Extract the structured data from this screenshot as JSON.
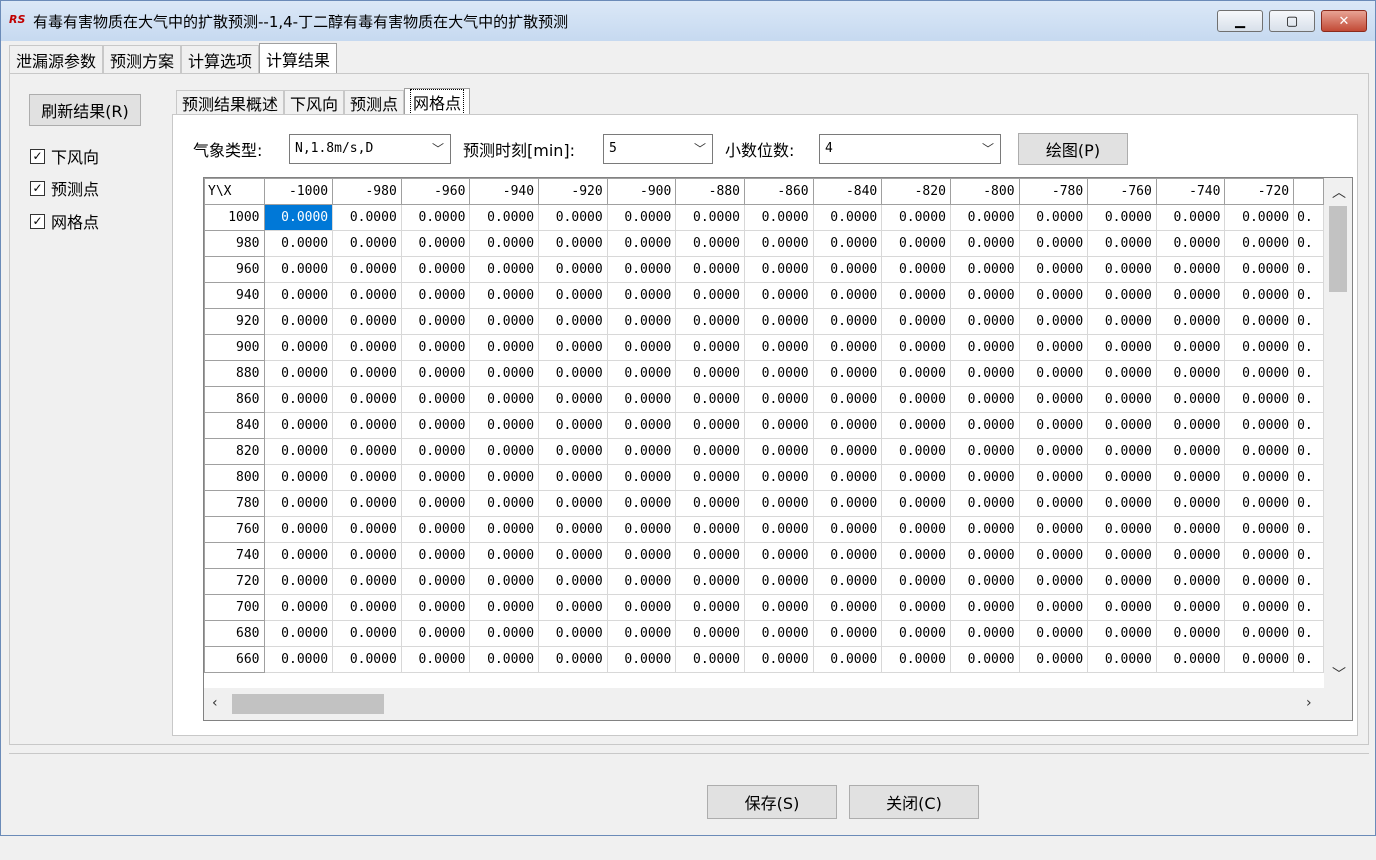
{
  "window": {
    "icon_text": "RS",
    "title": "有毒有害物质在大气中的扩散预测--1,4-丁二醇有毒有害物质在大气中的扩散预测",
    "min_icon": "minimize-icon",
    "max_icon": "maximize-icon",
    "close_icon": "close-icon"
  },
  "main_tabs": [
    "泄漏源参数",
    "预测方案",
    "计算选项",
    "计算结果"
  ],
  "left_panel": {
    "refresh_label": "刷新结果(R)",
    "checks": [
      {
        "label": "下风向",
        "checked": true
      },
      {
        "label": "预测点",
        "checked": true
      },
      {
        "label": "网格点",
        "checked": true
      }
    ]
  },
  "sub_tabs": [
    "预测结果概述",
    "下风向",
    "预测点",
    "网格点"
  ],
  "controls": {
    "weather_label": "气象类型:",
    "weather_value": "N,1.8m/s,D",
    "time_label": "预测时刻[min]:",
    "time_value": "5",
    "decimal_label": "小数位数:",
    "decimal_value": "4",
    "draw_label": "绘图(P)"
  },
  "grid": {
    "corner": "Y\\X",
    "columns": [
      "-1000",
      "-980",
      "-960",
      "-940",
      "-920",
      "-900",
      "-880",
      "-860",
      "-840",
      "-820",
      "-800",
      "-780",
      "-760",
      "-740",
      "-720"
    ],
    "truncated_cell": "0.",
    "rows": [
      "1000",
      "980",
      "960",
      "940",
      "920",
      "900",
      "880",
      "860",
      "840",
      "820",
      "800",
      "780",
      "760",
      "740",
      "720",
      "700",
      "680",
      "660"
    ],
    "cell_value": "0.0000",
    "selected": {
      "row": 0,
      "col": 0
    }
  },
  "buttons": {
    "save": "保存(S)",
    "close": "关闭(C)"
  }
}
